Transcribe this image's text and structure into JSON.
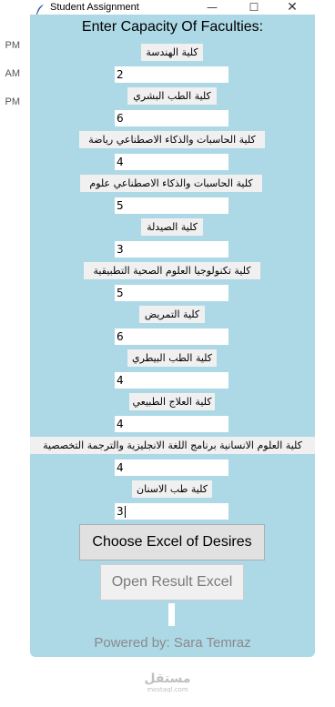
{
  "background_times": [
    "PM",
    "AM",
    "PM"
  ],
  "window": {
    "title": "Student Assignment",
    "controls": {
      "minimize": "—",
      "maximize": "☐",
      "close": "✕"
    }
  },
  "heading": "Enter Capacity Of Faculties:",
  "faculties": [
    {
      "label": "كلية الهندسة",
      "value": "2"
    },
    {
      "label": "كلية الطب البشري",
      "value": "6"
    },
    {
      "label": "كلية الحاسبات والذكاء الاصطناعي رياضة",
      "value": "4"
    },
    {
      "label": "كلية الحاسبات والذكاء الاصطناعي علوم",
      "value": "5"
    },
    {
      "label": "كلية الصيدلة",
      "value": "3"
    },
    {
      "label": "كلية تكنولوجيا العلوم الصحية التطبيقية",
      "value": "5"
    },
    {
      "label": "كلية التمريض",
      "value": "6"
    },
    {
      "label": "كلية الطب البيطري",
      "value": "4"
    },
    {
      "label": "كلية العلاج الطبيعي",
      "value": "4"
    },
    {
      "label": "كلية العلوم الانسانية برنامج اللغة الانجليزية والترجمة التخصصية",
      "value": "4"
    },
    {
      "label": "كلية طب الاسنان",
      "value": "3"
    }
  ],
  "buttons": {
    "choose_excel": "Choose Excel of Desires",
    "open_result": "Open Result Excel"
  },
  "footer": "Powered by: Sara Temraz",
  "watermark": {
    "main": "مستقل",
    "sub": "mostaql.com"
  }
}
